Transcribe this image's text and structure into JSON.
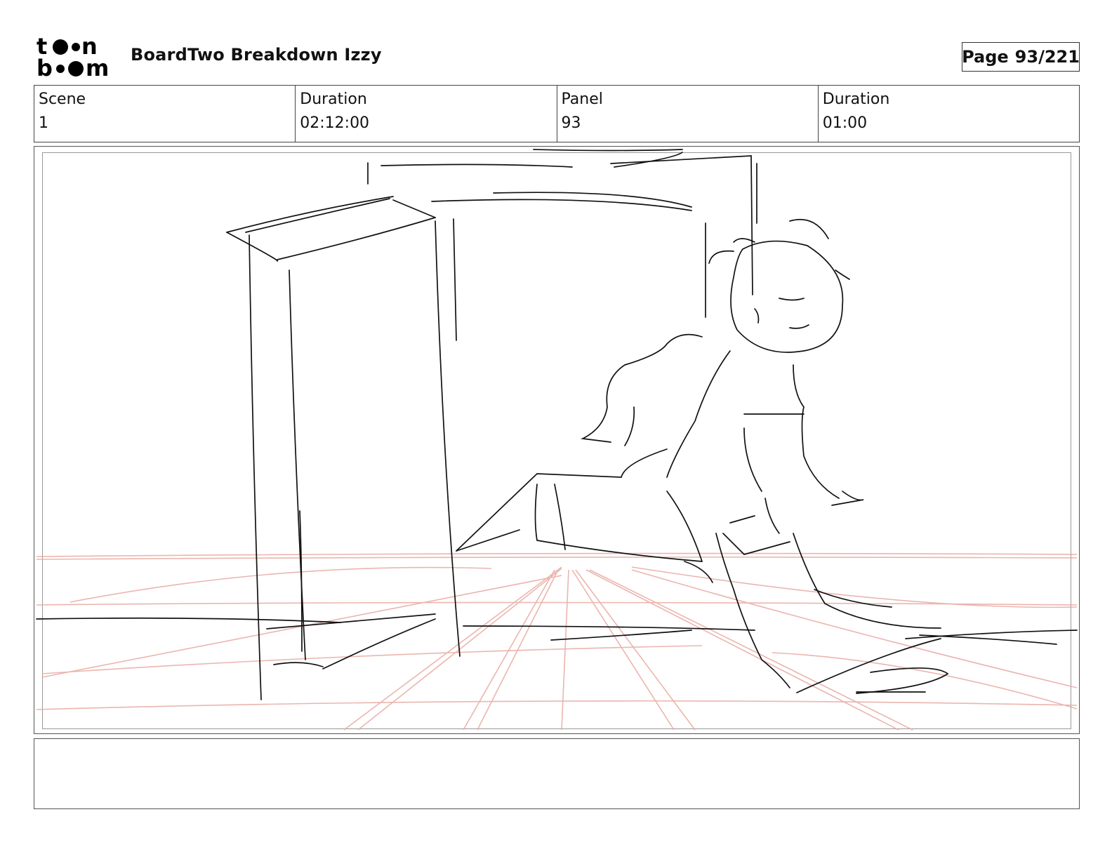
{
  "logo": {
    "text_line1": "toon",
    "text_line2": "boom",
    "icon": "toon-boom-logo"
  },
  "header": {
    "title": "BoardTwo Breakdown Izzy",
    "page_label": "Page",
    "page_value": "93/221"
  },
  "info": [
    {
      "label": "Scene",
      "value": "1"
    },
    {
      "label": "Duration",
      "value": "02:12:00"
    },
    {
      "label": "Panel",
      "value": "93"
    },
    {
      "label": "Duration",
      "value": "01:00"
    }
  ],
  "panel": {
    "image": "storyboard-sketch-character-running-past-doorway",
    "sketch_color": "#111111",
    "perspective_grid_color": "#e8a9a0"
  },
  "notes": {
    "text": ""
  }
}
